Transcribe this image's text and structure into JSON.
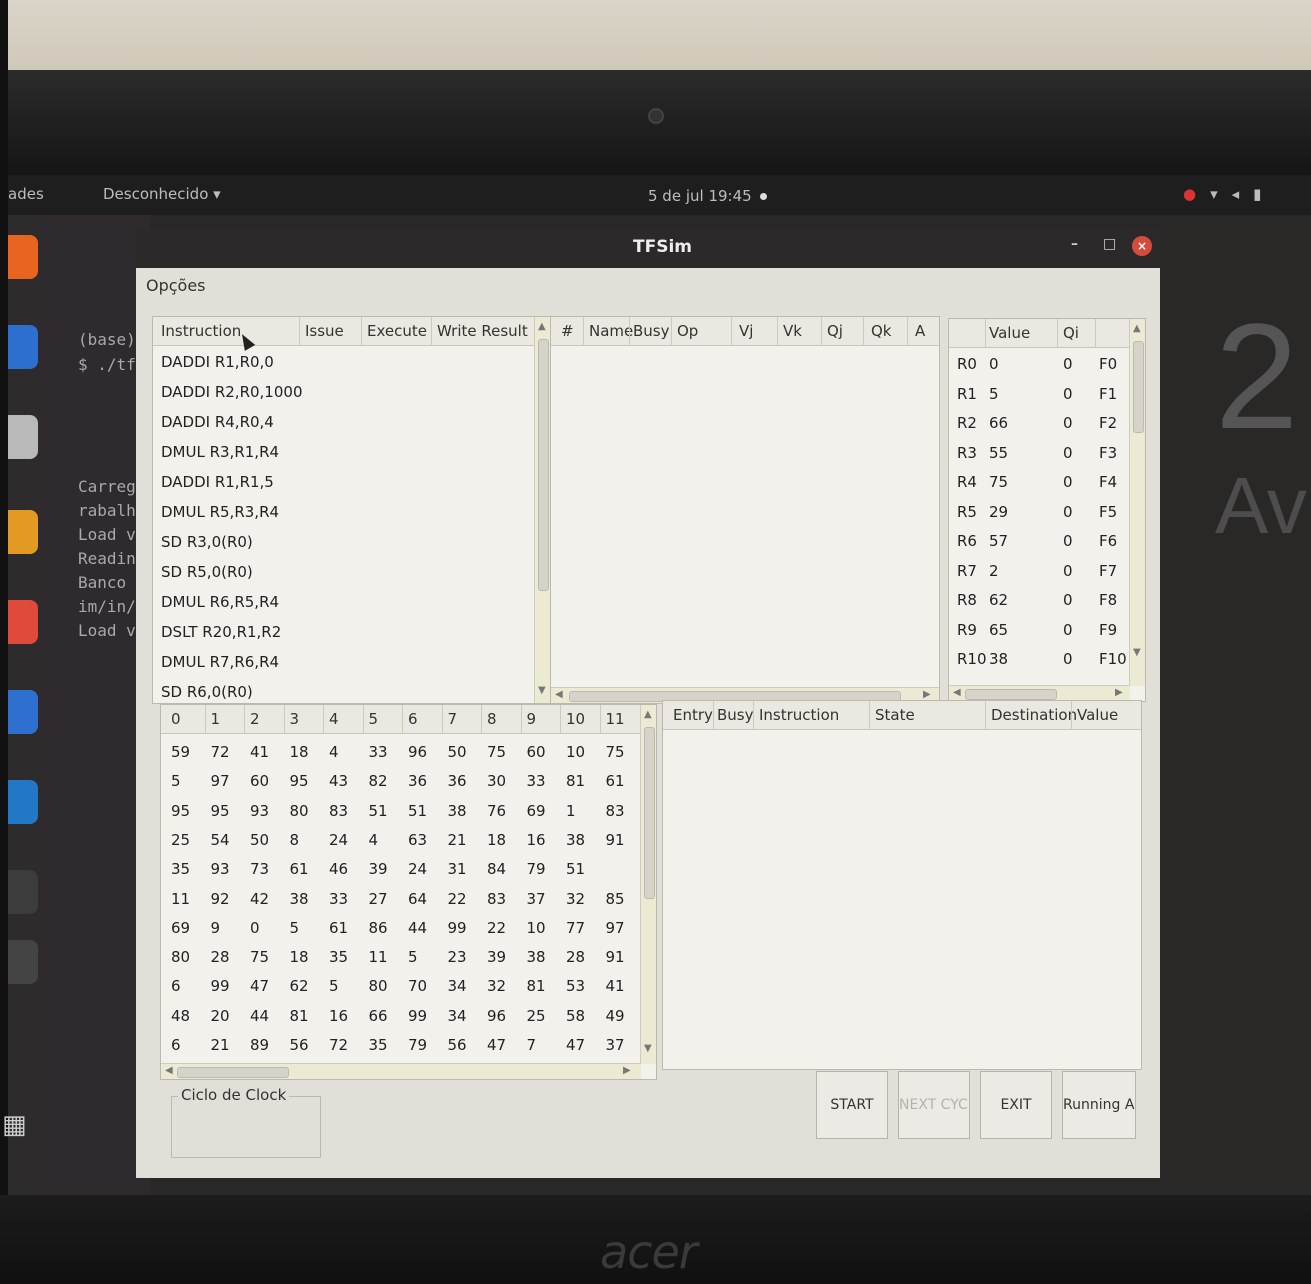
{
  "topbar": {
    "activities": "ades",
    "app_menu": "Desconhecido ▾",
    "clock": "5 de jul 19:45"
  },
  "window": {
    "title": "TFSim",
    "minimize": "–",
    "maximize": "□",
    "close": "×",
    "menu": "Opções"
  },
  "terminal": {
    "lines": [
      "(base)",
      "$ ./tf",
      "Carrega",
      "rabalho",
      "Load va",
      "Reading",
      "Banco d",
      "im/in/t",
      "Load va"
    ]
  },
  "background": {
    "big": "2",
    "sub": "Av"
  },
  "instruction_table": {
    "headers": [
      "Instruction",
      "Issue",
      "Execute",
      "Write Result"
    ],
    "rows": [
      "DADDI R1,R0,0",
      "DADDI R2,R0,1000",
      "DADDI R4,R0,4",
      "DMUL R3,R1,R4",
      "DADDI R1,R1,5",
      "DMUL R5,R3,R4",
      "SD R3,0(R0)",
      "SD R5,0(R0)",
      "DMUL R6,R5,R4",
      "DSLT R20,R1,R2",
      "DMUL R7,R6,R4",
      "SD R6,0(R0)"
    ]
  },
  "reservation_table": {
    "headers": [
      "#",
      "Name",
      "Busy",
      "Op",
      "Vj",
      "Vk",
      "Qj",
      "Qk",
      "A"
    ]
  },
  "register_table": {
    "headers": [
      "Value",
      "Qi"
    ],
    "rows": [
      {
        "reg": "R0",
        "value": "0",
        "qi": "0",
        "f": "F0"
      },
      {
        "reg": "R1",
        "value": "5",
        "qi": "0",
        "f": "F1"
      },
      {
        "reg": "R2",
        "value": "66",
        "qi": "0",
        "f": "F2"
      },
      {
        "reg": "R3",
        "value": "55",
        "qi": "0",
        "f": "F3"
      },
      {
        "reg": "R4",
        "value": "75",
        "qi": "0",
        "f": "F4"
      },
      {
        "reg": "R5",
        "value": "29",
        "qi": "0",
        "f": "F5"
      },
      {
        "reg": "R6",
        "value": "57",
        "qi": "0",
        "f": "F6"
      },
      {
        "reg": "R7",
        "value": "2",
        "qi": "0",
        "f": "F7"
      },
      {
        "reg": "R8",
        "value": "62",
        "qi": "0",
        "f": "F8"
      },
      {
        "reg": "R9",
        "value": "65",
        "qi": "0",
        "f": "F9"
      },
      {
        "reg": "R10",
        "value": "38",
        "qi": "0",
        "f": "F10"
      }
    ]
  },
  "memory_table": {
    "headers": [
      "0",
      "1",
      "2",
      "3",
      "4",
      "5",
      "6",
      "7",
      "8",
      "9",
      "10",
      "11"
    ],
    "rows": [
      [
        "59",
        "72",
        "41",
        "18",
        "4",
        "33",
        "96",
        "50",
        "75",
        "60",
        "10",
        "75"
      ],
      [
        "5",
        "97",
        "60",
        "95",
        "43",
        "82",
        "36",
        "36",
        "30",
        "33",
        "81",
        "61"
      ],
      [
        "95",
        "95",
        "93",
        "80",
        "83",
        "51",
        "51",
        "38",
        "76",
        "69",
        "1",
        "83"
      ],
      [
        "25",
        "54",
        "50",
        "8",
        "24",
        "4",
        "63",
        "21",
        "18",
        "16",
        "38",
        "91"
      ],
      [
        "35",
        "93",
        "73",
        "61",
        "46",
        "39",
        "24",
        "31",
        "84",
        "79",
        "51"
      ],
      [
        "11",
        "92",
        "42",
        "38",
        "33",
        "27",
        "64",
        "22",
        "83",
        "37",
        "32",
        "85"
      ],
      [
        "69",
        "9",
        "0",
        "5",
        "61",
        "86",
        "44",
        "99",
        "22",
        "10",
        "77",
        "97"
      ],
      [
        "80",
        "28",
        "75",
        "18",
        "35",
        "11",
        "5",
        "23",
        "39",
        "38",
        "28",
        "91"
      ],
      [
        "6",
        "99",
        "47",
        "62",
        "5",
        "80",
        "70",
        "34",
        "32",
        "81",
        "53",
        "41"
      ],
      [
        "48",
        "20",
        "44",
        "81",
        "16",
        "66",
        "99",
        "34",
        "96",
        "25",
        "58",
        "49"
      ],
      [
        "6",
        "21",
        "89",
        "56",
        "72",
        "35",
        "79",
        "56",
        "47",
        "7",
        "47",
        "37"
      ]
    ]
  },
  "rob_table": {
    "headers": [
      "Entry",
      "Busy",
      "Instruction",
      "State",
      "Destination",
      "Value"
    ]
  },
  "clock_group": {
    "label": "Ciclo de Clock"
  },
  "buttons": {
    "start": "START",
    "next_cycle": "NEXT CYCLE",
    "exit": "EXIT",
    "running_all": "Running All"
  },
  "brand": "acer"
}
